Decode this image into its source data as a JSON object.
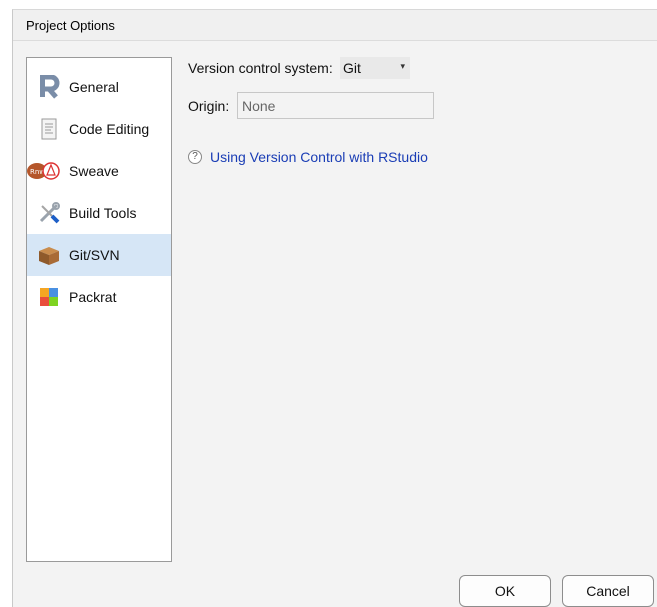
{
  "window": {
    "title": "Project Options"
  },
  "sidebar": {
    "items": [
      {
        "label": "General",
        "icon": "r-logo-icon",
        "selected": false
      },
      {
        "label": "Code Editing",
        "icon": "document-icon",
        "selected": false
      },
      {
        "label": "Sweave",
        "icon": "sweave-pdf-icon",
        "selected": false
      },
      {
        "label": "Build Tools",
        "icon": "wrench-screwdriver-icon",
        "selected": false
      },
      {
        "label": "Git/SVN",
        "icon": "package-box-icon",
        "selected": true
      },
      {
        "label": "Packrat",
        "icon": "packrat-blocks-icon",
        "selected": false
      }
    ]
  },
  "vcs": {
    "label": "Version control system:",
    "selected": "Git"
  },
  "origin": {
    "label": "Origin:",
    "value": "None"
  },
  "help": {
    "link_text": "Using Version Control with RStudio"
  },
  "buttons": {
    "ok": "OK",
    "cancel": "Cancel"
  },
  "colors": {
    "selected_bg": "#d6e6f6",
    "link": "#1a3db5",
    "dialog_bg": "#f3f3f3"
  }
}
